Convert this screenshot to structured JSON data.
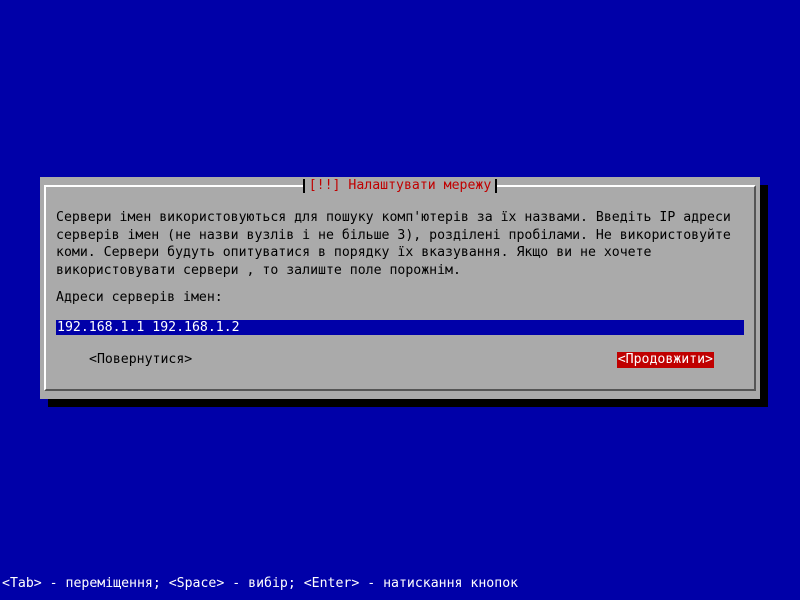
{
  "dialog": {
    "title": "[!!] Налаштувати мережу",
    "description": "Сервери імен використовуються для пошуку комп'ютерів за їх назвами. Введіть IP адреси\nсерверів імен (не назви вузлів і не більше 3), розділені пробілами. Не використовуйте\nкоми. Сервери будуть опитуватися в порядку їх вказування. Якщо ви не хочете\nвикористовувати сервери , то залиште поле порожнім.",
    "prompt_label": "Адреси серверів імен:",
    "input_value": "192.168.1.1 192.168.1.2",
    "back_button": "<Повернутися>",
    "continue_button": "<Продовжити>"
  },
  "status_bar": "<Tab> - переміщення; <Space> - вибір; <Enter> - натискання кнопок",
  "colors": {
    "background": "#0000a8",
    "dialog": "#aaaaaa",
    "title": "#c00000",
    "focused_button": "#c00000",
    "input_bg": "#0000a8",
    "input_text": "#ffffff"
  }
}
